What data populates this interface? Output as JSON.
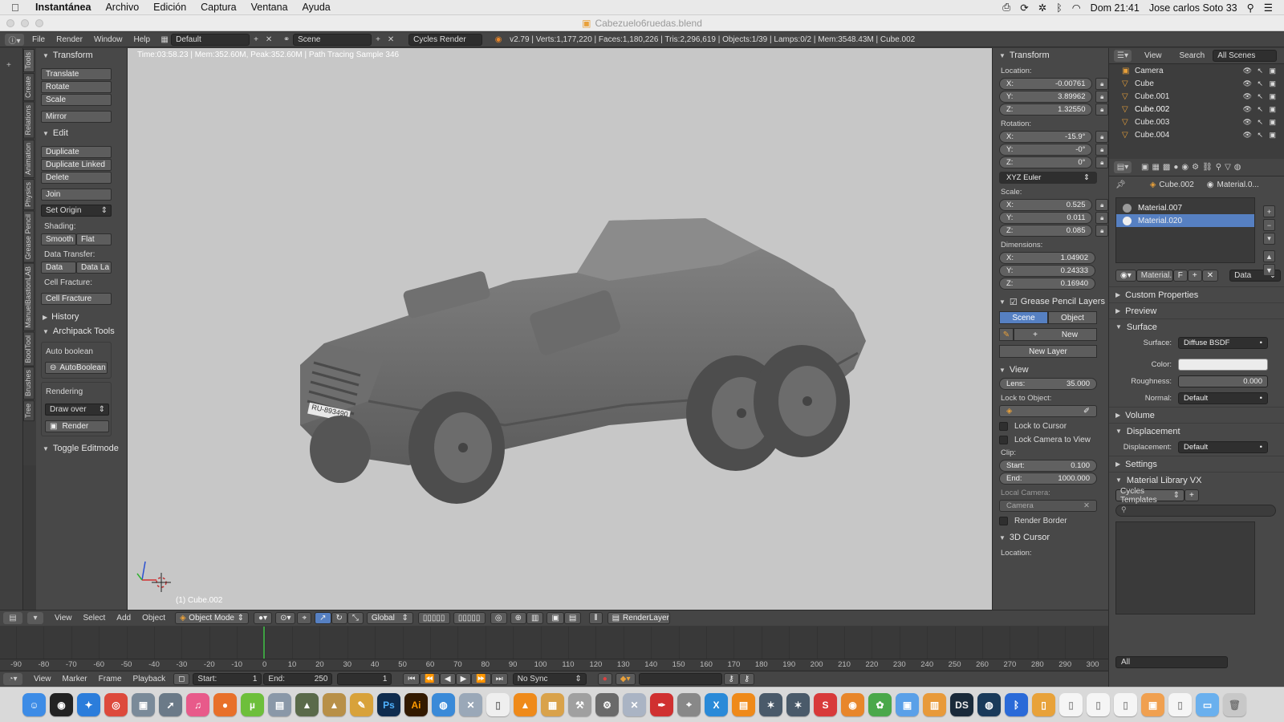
{
  "mac_menubar": {
    "app": "Instantánea",
    "menus": [
      "Archivo",
      "Edición",
      "Captura",
      "Ventana",
      "Ayuda"
    ],
    "clock": "Dom 21:41",
    "user": "Jose carlos Soto 33"
  },
  "window": {
    "title": "Cabezuelo6ruedas.blend"
  },
  "info_header": {
    "menus": [
      "File",
      "Render",
      "Window",
      "Help"
    ],
    "layout": "Default",
    "scene": "Scene",
    "engine": "Cycles Render",
    "stats": "v2.79 | Verts:1,177,220 | Faces:1,180,226 | Tris:2,296,619 | Objects:1/39 | Lamps:0/2 | Mem:3548.43M | Cube.002"
  },
  "tool_tabs": [
    "Tools",
    "Create",
    "Relations",
    "Animation",
    "Physics",
    "Grease Pencil",
    "ManuelBastionLAB",
    "BoolTool",
    "Brushes",
    "Tree"
  ],
  "tools_panel": {
    "transform": {
      "title": "Transform",
      "buttons": [
        "Translate",
        "Rotate",
        "Scale",
        "Mirror"
      ]
    },
    "edit": {
      "title": "Edit",
      "buttons": [
        "Duplicate",
        "Duplicate Linked",
        "Delete",
        "Join"
      ],
      "set_origin": "Set Origin"
    },
    "shading": {
      "label": "Shading:",
      "smooth": "Smooth",
      "flat": "Flat"
    },
    "data_transfer": {
      "label": "Data Transfer:",
      "data": "Data",
      "data_la": "Data La"
    },
    "cell_fracture": {
      "label": "Cell Fracture:",
      "button": "Cell Fracture"
    },
    "history": "History",
    "archipack": {
      "title": "Archipack Tools",
      "auto_boolean_label": "Auto boolean",
      "auto_boolean_btn": "AutoBoolean",
      "rendering_label": "Rendering",
      "draw_over": "Draw over",
      "render": "Render"
    },
    "toggle_editmode": "Toggle Editmode"
  },
  "viewport": {
    "render_status": "Time:03:58.23 | Mem:352.60M, Peak:352.60M | Path Tracing Sample 346",
    "object_label": "(1) Cube.002",
    "plate": "RU-893490"
  },
  "view3d_header": {
    "menus": [
      "View",
      "Select",
      "Add",
      "Object"
    ],
    "mode": "Object Mode",
    "orientation": "Global",
    "render_layer": "RenderLayer"
  },
  "timeline": {
    "ticks": [
      "-90",
      "-80",
      "-70",
      "-60",
      "-50",
      "-40",
      "-30",
      "-20",
      "-10",
      "0",
      "10",
      "20",
      "30",
      "40",
      "50",
      "60",
      "70",
      "80",
      "90",
      "100",
      "110",
      "120",
      "130",
      "140",
      "150",
      "160",
      "170",
      "180",
      "190",
      "200",
      "210",
      "220",
      "230",
      "240",
      "250",
      "260",
      "270",
      "280",
      "290",
      "300"
    ],
    "menus": [
      "View",
      "Marker",
      "Frame",
      "Playback"
    ],
    "start_label": "Start:",
    "start": "1",
    "end_label": "End:",
    "end": "250",
    "current": "1",
    "sync": "No Sync"
  },
  "n_panel": {
    "transform_title": "Transform",
    "location_label": "Location:",
    "location": {
      "x": "-0.00761",
      "y": "3.89962",
      "z": "1.32550"
    },
    "rotation_label": "Rotation:",
    "rotation": {
      "x": "-15.9°",
      "y": "-0°",
      "z": "0°"
    },
    "rotation_mode": "XYZ Euler",
    "scale_label": "Scale:",
    "scale": {
      "x": "0.525",
      "y": "0.011",
      "z": "0.085"
    },
    "dimensions_label": "Dimensions:",
    "dimensions": {
      "x": "1.04902",
      "y": "0.24333",
      "z": "0.16940"
    },
    "grease_pencil": "Grease Pencil Layers",
    "scene_btn": "Scene",
    "object_btn": "Object",
    "new_btn": "New",
    "new_layer": "New Layer",
    "view_title": "View",
    "lens_label": "Lens:",
    "lens": "35.000",
    "lock_to_object": "Lock to Object:",
    "lock_to_cursor": "Lock to Cursor",
    "lock_camera": "Lock Camera to View",
    "clip_label": "Clip:",
    "clip_start_label": "Start:",
    "clip_start": "0.100",
    "clip_end_label": "End:",
    "clip_end": "1000.000",
    "local_camera": "Local Camera:",
    "camera": "Camera",
    "render_border": "Render Border",
    "cursor_title": "3D Cursor",
    "cursor_location": "Location:"
  },
  "outliner": {
    "view": "View",
    "search": "Search",
    "scope": "All Scenes",
    "items": [
      "Camera",
      "Cube",
      "Cube.001",
      "Cube.002",
      "Cube.003",
      "Cube.004"
    ]
  },
  "properties": {
    "breadcrumb_object": "Cube.002",
    "breadcrumb_material": "Material.0...",
    "slots": [
      "Material.007",
      "Material.020"
    ],
    "material_field": "Material.",
    "f_label": "F",
    "data_select": "Data",
    "sections": {
      "custom": "Custom Properties",
      "preview": "Preview",
      "surface": "Surface",
      "volume": "Volume",
      "displacement": "Displacement",
      "settings": "Settings",
      "library": "Material Library VX"
    },
    "surface_label": "Surface:",
    "surface_value": "Diffuse BSDF",
    "color_label": "Color:",
    "roughness_label": "Roughness:",
    "roughness": "0.000",
    "normal_label": "Normal:",
    "normal_value": "Default",
    "displacement_label": "Displacement:",
    "displacement_value": "Default",
    "templates": "Cycles Templates",
    "all": "All"
  },
  "colors": {
    "accent": "#5680c2",
    "viewport_bg": "#c7c7c7",
    "frame_marker": "#3ea142"
  }
}
